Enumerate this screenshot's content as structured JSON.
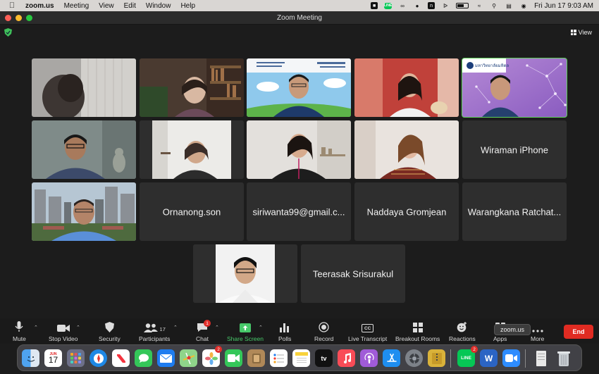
{
  "menubar": {
    "app": "zoom.us",
    "items": [
      "Meeting",
      "View",
      "Edit",
      "Window",
      "Help"
    ],
    "line_icon_text": "LINE",
    "clock": "Fri Jun 17  9:03 AM"
  },
  "window": {
    "title": "Zoom Meeting"
  },
  "view_button": "View",
  "participants": [
    {
      "kind": "video",
      "scene": "dark-curtain"
    },
    {
      "kind": "video",
      "scene": "bookshelf"
    },
    {
      "kind": "video",
      "scene": "slide-sky"
    },
    {
      "kind": "video",
      "scene": "red-room"
    },
    {
      "kind": "video",
      "scene": "purple-network",
      "active": true,
      "logo_text": "มหาวิทยาลัยมหิดล"
    },
    {
      "kind": "video",
      "scene": "office-man"
    },
    {
      "kind": "video",
      "scene": "white-wall"
    },
    {
      "kind": "video",
      "scene": "shelf-woman"
    },
    {
      "kind": "video",
      "scene": "woman-down"
    },
    {
      "kind": "name",
      "name": "Wiraman iPhone"
    },
    {
      "kind": "video",
      "scene": "city"
    },
    {
      "kind": "name",
      "name": "Ornanong.son"
    },
    {
      "kind": "name",
      "name": "siriwanta99@gmail.c..."
    },
    {
      "kind": "name",
      "name": "Naddaya Gromjean"
    },
    {
      "kind": "name",
      "name": "Warangkana Ratchat..."
    },
    {
      "kind": "video",
      "scene": "portrait"
    },
    {
      "kind": "name",
      "name": "Teerasak Srisurakul"
    }
  ],
  "toolbar": {
    "mute": "Mute",
    "stop_video": "Stop Video",
    "security": "Security",
    "participants": "Participants",
    "participants_count": "17",
    "chat": "Chat",
    "chat_badge": "1",
    "share_screen": "Share Screen",
    "polls": "Polls",
    "record": "Record",
    "live_transcript": "Live Transcript",
    "cc_icon_text": "CC",
    "breakout_rooms": "Breakout Rooms",
    "reactions": "Reactions",
    "apps": "Apps",
    "more": "More",
    "end": "End",
    "tooltip": "zoom.us"
  },
  "dock": {
    "calendar_month": "JUN",
    "calendar_day": "17",
    "photos_badge": "2",
    "line_badge": "2",
    "tv_label": "tv",
    "word_label": "W",
    "line_label": "LINE",
    "items": [
      "finder",
      "calendar",
      "launchpad",
      "safari",
      "news",
      "messages",
      "mail",
      "maps",
      "photos",
      "facetime",
      "notes-app",
      "reminders",
      "notes",
      "tv",
      "music",
      "podcasts",
      "app-store",
      "settings",
      "archive",
      "line",
      "word",
      "zoom",
      "documents",
      "trash"
    ]
  },
  "colors": {
    "accent_green": "#47c96a",
    "end_red": "#e02b22",
    "active_border": "#5fd15a"
  }
}
